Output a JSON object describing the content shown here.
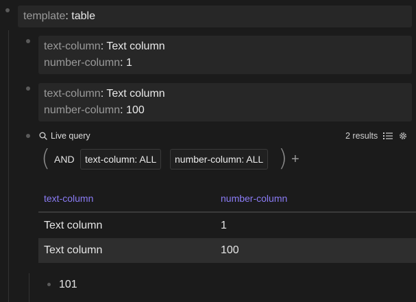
{
  "template_block": {
    "key": "template",
    "value": "table"
  },
  "entries": [
    {
      "text_key": "text-column",
      "text_value": "Text column",
      "num_key": "number-column",
      "num_value": "1"
    },
    {
      "text_key": "text-column",
      "text_value": "Text column",
      "num_key": "number-column",
      "num_value": "100"
    }
  ],
  "query": {
    "title": "Live query",
    "results": "2 results",
    "operator": "AND",
    "filters": [
      "text-column: ALL",
      "number-column: ALL"
    ],
    "add_symbol": "+",
    "paren_open": "(",
    "paren_close": ")"
  },
  "table": {
    "headers": [
      "text-column",
      "number-column"
    ],
    "rows": [
      [
        "Text column",
        "1"
      ],
      [
        "Text column",
        "100"
      ]
    ],
    "header_color": "#8b7cf6"
  },
  "last_item": "101",
  "icons": {
    "search": "search-icon",
    "list": "list-icon",
    "settings": "gear-icon"
  }
}
